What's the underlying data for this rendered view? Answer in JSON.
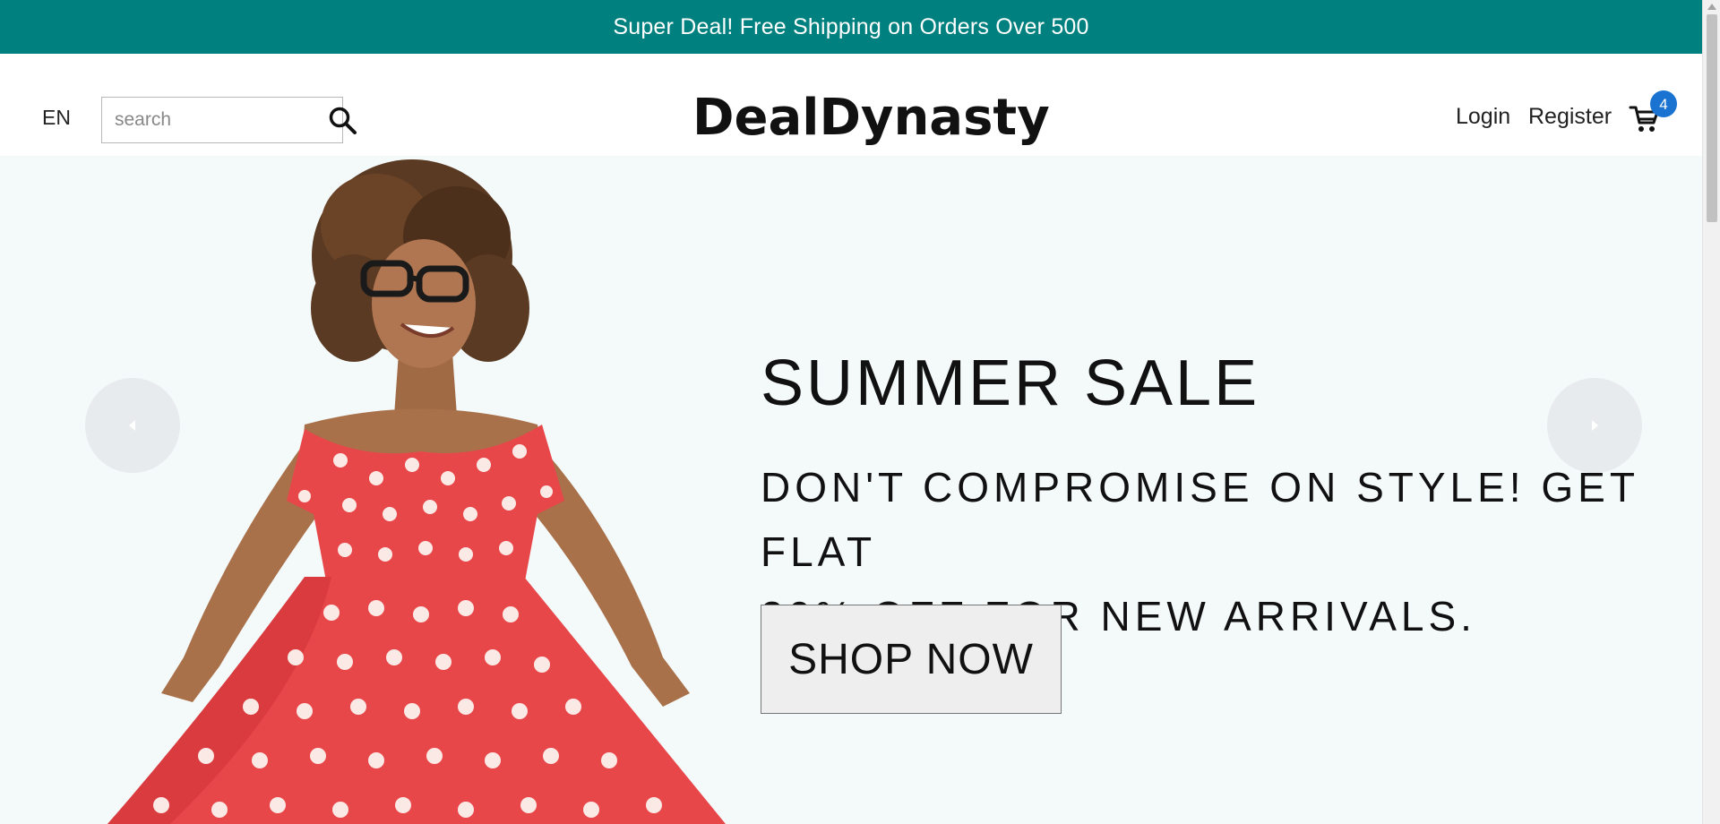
{
  "announcement": {
    "text": "Super Deal! Free Shipping on Orders Over 500"
  },
  "header": {
    "language": "EN",
    "search": {
      "placeholder": "search",
      "value": "",
      "icon": "search-icon"
    },
    "logo_text": "DealDynasty",
    "login_label": "Login",
    "register_label": "Register",
    "cart": {
      "icon": "shopping-cart-icon",
      "count": "4"
    }
  },
  "hero": {
    "title": "SUMMER SALE",
    "description": "DON'T COMPROMISE ON STYLE! GET FLAT\n30% OFF FOR NEW ARRIVALS.",
    "button_label": "SHOP NOW",
    "image_subject": "woman in red polka dot dress",
    "prev_icon": "arrow-left-icon",
    "next_icon": "arrow-right-icon"
  },
  "colors": {
    "announcement_bg": "#00807f",
    "hero_bg": "#f4f9fa",
    "badge_bg": "#1a73d1",
    "dress_red": "#e8474a",
    "arrow_bg": "#e7ebee"
  }
}
